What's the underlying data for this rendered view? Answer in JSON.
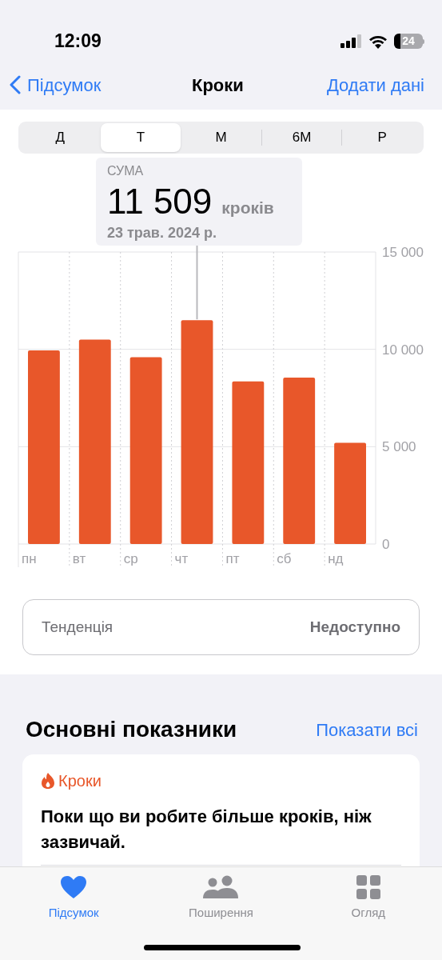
{
  "status_bar": {
    "time": "12:09",
    "battery": "24"
  },
  "nav": {
    "back": "Підсумок",
    "title": "Кроки",
    "action": "Додати дані"
  },
  "segments": [
    {
      "label": "Д",
      "selected": false
    },
    {
      "label": "Т",
      "selected": true
    },
    {
      "label": "М",
      "selected": false
    },
    {
      "label": "6М",
      "selected": false
    },
    {
      "label": "Р",
      "selected": false
    }
  ],
  "callout": {
    "label": "СУМА",
    "value": "11 509",
    "unit": "кроків",
    "date": "23 трав. 2024 р."
  },
  "chart_data": {
    "type": "bar",
    "categories": [
      "пн",
      "вт",
      "ср",
      "чт",
      "пт",
      "сб",
      "нд"
    ],
    "series": [
      {
        "color": "#e8572a",
        "values": [
          9950,
          10500,
          9600,
          11500,
          8350,
          8550,
          5200
        ]
      }
    ],
    "ylim": [
      0,
      15000
    ],
    "yticks": [
      {
        "value": 0,
        "label": "0"
      },
      {
        "value": 5000,
        "label": "5 000"
      },
      {
        "value": 10000,
        "label": "10 000"
      },
      {
        "value": 15000,
        "label": "15 000"
      }
    ]
  },
  "trend": {
    "label": "Тенденція",
    "value": "Недоступно"
  },
  "highlights": {
    "title": "Основні показники",
    "link": "Показати всі",
    "card": {
      "category": "Кроки",
      "text": "Поки що ви робите більше кроків, ніж зазвичай."
    }
  },
  "tab_bar": [
    {
      "label": "Підсумок",
      "selected": true
    },
    {
      "label": "Поширення",
      "selected": false
    },
    {
      "label": "Огляд",
      "selected": false
    }
  ]
}
